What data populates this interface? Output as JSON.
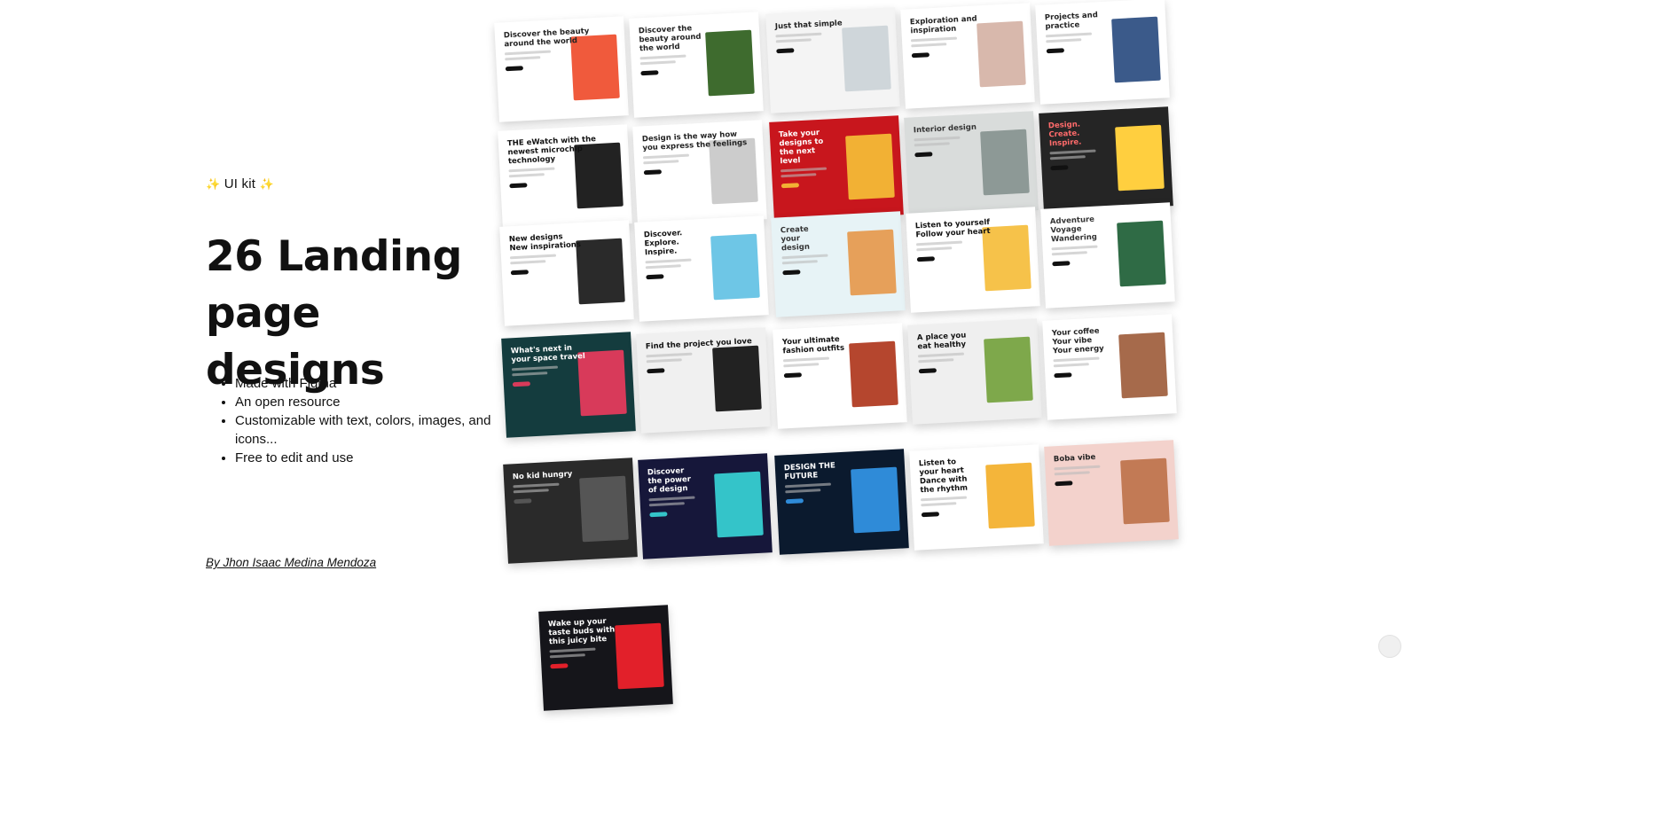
{
  "hero": {
    "tag_label": "UI kit",
    "tag_emoji": "✨",
    "title_line1": "26 Landing",
    "title_line2": "page designs",
    "features": [
      "Made with Figma",
      "An open resource",
      "Customizable with text, colors, images, and icons...",
      "Free to edit and use"
    ],
    "author": "By Jhon Isaac Medina Mendoza"
  },
  "tiles": [
    {
      "title": "Discover the beauty\naround the world",
      "bg": "#ffffff",
      "fg": "#222222",
      "accent": "#f05a3c"
    },
    {
      "title": "Discover the\nbeauty around\nthe world",
      "bg": "#ffffff",
      "fg": "#222222",
      "accent": "#3e6b2e"
    },
    {
      "title": "Just that simple",
      "bg": "#f4f4f4",
      "fg": "#222222",
      "accent": "#cfd6da"
    },
    {
      "title": "Exploration and\ninspiration",
      "bg": "#ffffff",
      "fg": "#222222",
      "accent": "#d8b8ac"
    },
    {
      "title": "Projects and\npractice",
      "bg": "#ffffff",
      "fg": "#222222",
      "accent": "#3b5a8a"
    },
    {
      "title": "THE eWatch with the\nnewest microchip\ntechnology",
      "bg": "#ffffff",
      "fg": "#111111",
      "accent": "#222222"
    },
    {
      "title": "Design is the way how\nyou express the feelings",
      "bg": "#ffffff",
      "fg": "#222222",
      "accent": "#cccccc"
    },
    {
      "title": "Take your\ndesigns to\nthe next\nlevel",
      "bg": "#c8161d",
      "fg": "#ffffff",
      "accent": "#f2b134"
    },
    {
      "title": "Interior design",
      "bg": "#d9dcdb",
      "fg": "#333333",
      "accent": "#8d9996"
    },
    {
      "title": "Design.\nCreate.\nInspire.",
      "bg": "#252525",
      "fg": "#ff6b6b",
      "accent": "#ffcf3f"
    },
    {
      "title": "New designs\nNew inspirations",
      "bg": "#ffffff",
      "fg": "#111111",
      "accent": "#2a2a2a"
    },
    {
      "title": "Discover.\nExplore.\nInspire.",
      "bg": "#ffffff",
      "fg": "#111111",
      "accent": "#6ec6e6"
    },
    {
      "title": "Create\nyour\ndesign",
      "bg": "#e7f3f6",
      "fg": "#333333",
      "accent": "#e6a05a"
    },
    {
      "title": "Listen to yourself\nFollow your heart",
      "bg": "#ffffff",
      "fg": "#111111",
      "accent": "#f6c24a"
    },
    {
      "title": "Adventure\nVoyage\nWandering",
      "bg": "#ffffff",
      "fg": "#333333",
      "accent": "#2f6b45"
    },
    {
      "title": "What's next in\nyour space travel",
      "bg": "#143c3e",
      "fg": "#ffffff",
      "accent": "#d83a5a"
    },
    {
      "title": "Find the project you love",
      "bg": "#f0f0f0",
      "fg": "#111111",
      "accent": "#222222"
    },
    {
      "title": "Your ultimate\nfashion outfits",
      "bg": "#ffffff",
      "fg": "#111111",
      "accent": "#b5462e"
    },
    {
      "title": "A place you\neat healthy",
      "bg": "#efefef",
      "fg": "#111111",
      "accent": "#7ea84b"
    },
    {
      "title": "Your coffee\nYour vibe\nYour energy",
      "bg": "#ffffff",
      "fg": "#222222",
      "accent": "#a66a4b"
    },
    {
      "title": "No kid hungry",
      "bg": "#2a2a2a",
      "fg": "#ffffff",
      "accent": "#555555"
    },
    {
      "title": "Discover\nthe power\nof design",
      "bg": "#16173a",
      "fg": "#ffffff",
      "accent": "#34c4c9"
    },
    {
      "title": "DESIGN THE\nFUTURE",
      "bg": "#0b1a2e",
      "fg": "#ffffff",
      "accent": "#2f8bd8"
    },
    {
      "title": "Listen to\nyour heart\nDance with\nthe rhythm",
      "bg": "#ffffff",
      "fg": "#111111",
      "accent": "#f4b53a"
    },
    {
      "title": "Boba vibe",
      "bg": "#f3d2cc",
      "fg": "#222222",
      "accent": "#c27a55"
    },
    {
      "title": "Wake up your\ntaste buds with\nthis juicy bite",
      "bg": "#15151a",
      "fg": "#ffffff",
      "accent": "#e2202a"
    }
  ]
}
